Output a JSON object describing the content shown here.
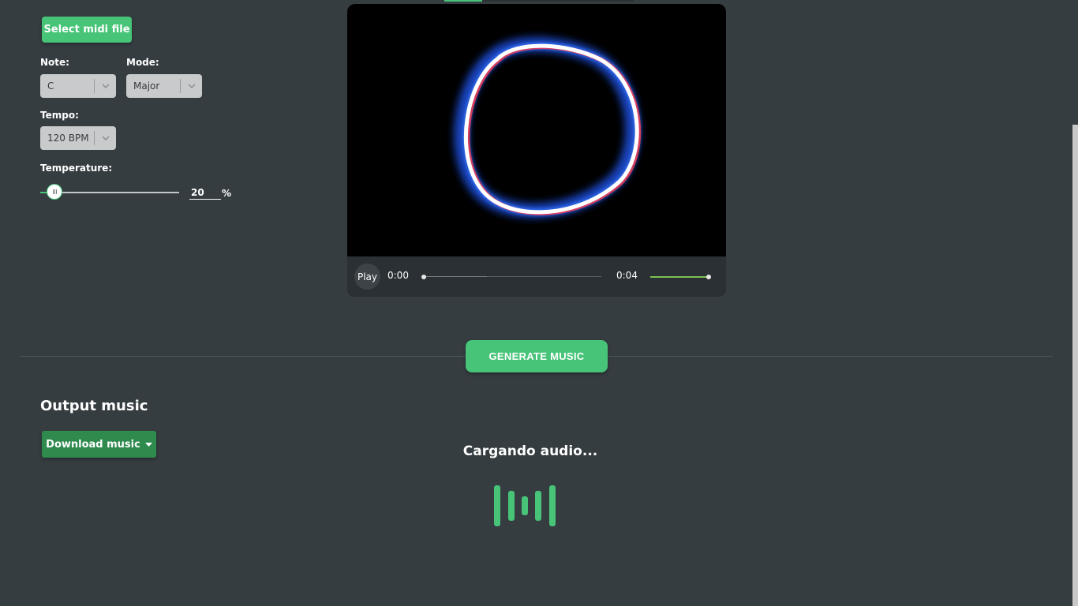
{
  "top_tabs": {
    "active_indicator_color": "#46c47a"
  },
  "controls": {
    "select_midi_label": "Select midi file",
    "note": {
      "label": "Note:",
      "value": "C"
    },
    "mode": {
      "label": "Mode:",
      "value": "Major"
    },
    "tempo": {
      "label": "Tempo:",
      "value": "120 BPM"
    },
    "temperature": {
      "label": "Temperature:",
      "value": "20",
      "unit": "%",
      "level_percent": 20
    }
  },
  "video": {
    "play_label": "Play",
    "current_time": "0:00",
    "duration": "0:04",
    "progress_fraction": 0,
    "volume_fraction": 1
  },
  "generate_label": "GENERATE MUSIC",
  "output": {
    "title": "Output music",
    "download_label": "Download music",
    "loading_text": "Cargando audio..."
  },
  "colors": {
    "accent": "#48c479",
    "download": "#2f8a4e",
    "background": "#363d41"
  }
}
